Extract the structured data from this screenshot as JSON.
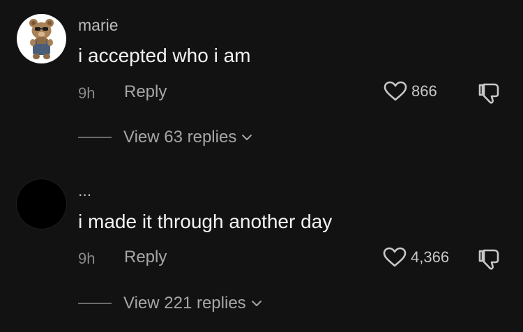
{
  "colors": {
    "background": "#121212",
    "text_primary": "#f2f2f2",
    "text_muted": "#a6a6a6"
  },
  "comments": [
    {
      "username": "marie",
      "avatar": "teddy-bear-avatar",
      "text": "i accepted who i am",
      "time": "9h",
      "reply_label": "Reply",
      "likes": "866",
      "view_replies": "View 63 replies"
    },
    {
      "username": "...",
      "avatar": "dark-avatar",
      "text": "i made it through another day",
      "time": "9h",
      "reply_label": "Reply",
      "likes": "4,366",
      "view_replies": "View 221 replies"
    }
  ]
}
